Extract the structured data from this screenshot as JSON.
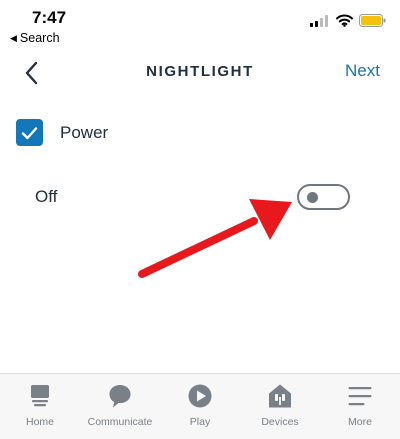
{
  "status_bar": {
    "time": "7:47",
    "back_to_app": "Search"
  },
  "header": {
    "title": "NIGHTLIGHT",
    "next_label": "Next"
  },
  "power": {
    "label": "Power",
    "checked": true
  },
  "state": {
    "label": "Off",
    "toggle_on": false
  },
  "bottom_nav": [
    {
      "label": "Home",
      "icon": "home-icon"
    },
    {
      "label": "Communicate",
      "icon": "communicate-icon"
    },
    {
      "label": "Play",
      "icon": "play-icon"
    },
    {
      "label": "Devices",
      "icon": "devices-icon"
    },
    {
      "label": "More",
      "icon": "more-icon"
    }
  ],
  "colors": {
    "accent": "#1377b9",
    "link": "#1a73ad",
    "text": "#232f3e",
    "annotation_arrow": "#e8191c",
    "nav_icon": "#7a8088",
    "battery": "#f4c20d"
  }
}
